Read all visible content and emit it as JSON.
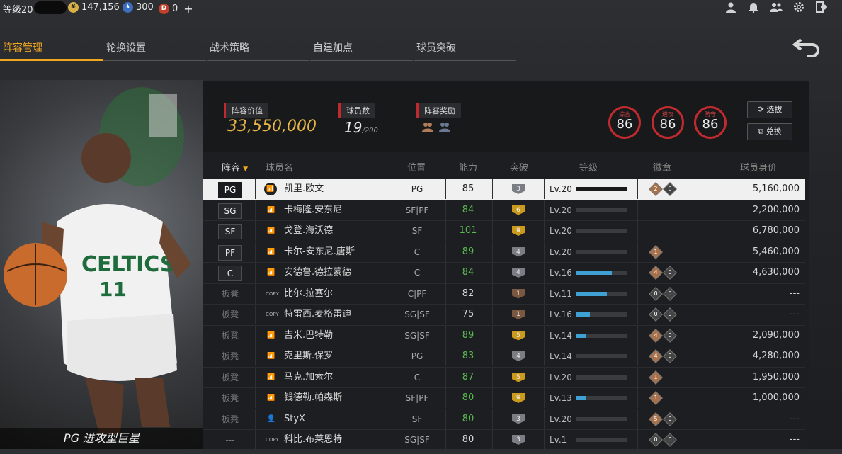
{
  "topbar": {
    "level": "等级20",
    "coins": "147,156",
    "stars": "300",
    "diamonds": "0",
    "plus": "+"
  },
  "tabs": [
    "阵容管理",
    "轮换设置",
    "战术策略",
    "自建加点",
    "球员突破"
  ],
  "art": {
    "caption": "PG 进攻型巨星"
  },
  "summary": {
    "lineup_value_label": "阵容价值",
    "lineup_value": "33,550,000",
    "player_count_label": "球员数",
    "player_count": "19",
    "player_count_max": "/200",
    "reward_label": "阵容奖励",
    "ratings": [
      {
        "label": "综合",
        "value": "86"
      },
      {
        "label": "进攻",
        "value": "86"
      },
      {
        "label": "防守",
        "value": "86"
      }
    ],
    "scout_button": "选拔",
    "exchange_button": "兑换"
  },
  "table": {
    "headers": {
      "lineup": "阵容",
      "name": "球员名",
      "position": "位置",
      "ability": "能力",
      "breakthrough": "突破",
      "level": "等级",
      "badges": "徽章",
      "value": "球员身价"
    },
    "rows": [
      {
        "slot": "PG",
        "bench": false,
        "icon": "bars",
        "name": "凯里.欧文",
        "pos": "PG",
        "ability": "85",
        "green": false,
        "brk": "3",
        "brk_color": "#7a7d84",
        "lv": "Lv.20",
        "lvfill": 1.0,
        "badges": [
          {
            "n": "2",
            "c": "gold"
          },
          {
            "n": "0",
            "c": "grey"
          }
        ],
        "value": "5,160,000",
        "selected": true
      },
      {
        "slot": "SG",
        "bench": false,
        "icon": "bars",
        "name": "卡梅隆.安东尼",
        "pos": "SF|PF",
        "ability": "84",
        "green": true,
        "brk": "6",
        "brk_color": "#c99a1c",
        "lv": "Lv.20",
        "lvfill": 0,
        "badges": [],
        "value": "2,200,000"
      },
      {
        "slot": "SF",
        "bench": false,
        "icon": "bars",
        "name": "戈登.海沃德",
        "pos": "SF",
        "ability": "101",
        "green": true,
        "brk": "♛",
        "brk_color": "#c99a1c",
        "lv": "Lv.20",
        "lvfill": 0,
        "badges": [],
        "value": "6,780,000"
      },
      {
        "slot": "PF",
        "bench": false,
        "icon": "bars",
        "name": "卡尔-安东尼.唐斯",
        "pos": "C",
        "ability": "89",
        "green": true,
        "brk": "4",
        "brk_color": "#7a7d84",
        "lv": "Lv.20",
        "lvfill": 0,
        "badges": [
          {
            "n": "1",
            "c": "gold"
          }
        ],
        "value": "5,460,000"
      },
      {
        "slot": "C",
        "bench": false,
        "icon": "bars",
        "name": "安德鲁.德拉蒙德",
        "pos": "C",
        "ability": "84",
        "green": true,
        "brk": "4",
        "brk_color": "#7a7d84",
        "lv": "Lv.16",
        "lvfill": 0.7,
        "badges": [
          {
            "n": "4",
            "c": "gold"
          },
          {
            "n": "0",
            "c": "grey"
          }
        ],
        "value": "4,630,000"
      },
      {
        "slot": "板凳",
        "bench": true,
        "icon": "COPY",
        "name": "比尔.拉塞尔",
        "pos": "C|PF",
        "ability": "82",
        "green": false,
        "brk": "1",
        "brk_color": "#7a5840",
        "lv": "Lv.11",
        "lvfill": 0.6,
        "badges": [
          {
            "n": "0",
            "c": "grey"
          },
          {
            "n": "0",
            "c": "grey"
          }
        ],
        "value": "---"
      },
      {
        "slot": "板凳",
        "bench": true,
        "icon": "COPY",
        "name": "特雷西.麦格雷迪",
        "pos": "SG|SF",
        "ability": "75",
        "green": false,
        "brk": "1",
        "brk_color": "#7a5840",
        "lv": "Lv.16",
        "lvfill": 0.26,
        "badges": [
          {
            "n": "0",
            "c": "grey"
          },
          {
            "n": "0",
            "c": "grey"
          }
        ],
        "value": "---"
      },
      {
        "slot": "板凳",
        "bench": true,
        "icon": "bars",
        "name": "吉米.巴特勒",
        "pos": "SG|SF",
        "ability": "89",
        "green": true,
        "brk": "5",
        "brk_color": "#c99a1c",
        "lv": "Lv.14",
        "lvfill": 0.2,
        "badges": [
          {
            "n": "4",
            "c": "gold"
          },
          {
            "n": "0",
            "c": "grey"
          }
        ],
        "value": "2,090,000"
      },
      {
        "slot": "板凳",
        "bench": true,
        "icon": "bars",
        "name": "克里斯.保罗",
        "pos": "PG",
        "ability": "83",
        "green": true,
        "brk": "4",
        "brk_color": "#7a7d84",
        "lv": "Lv.14",
        "lvfill": 0,
        "badges": [
          {
            "n": "4",
            "c": "gold"
          },
          {
            "n": "0",
            "c": "grey"
          }
        ],
        "value": "4,280,000"
      },
      {
        "slot": "板凳",
        "bench": true,
        "icon": "bars",
        "name": "马克.加索尔",
        "pos": "C",
        "ability": "87",
        "green": true,
        "brk": "5",
        "brk_color": "#c99a1c",
        "lv": "Lv.20",
        "lvfill": 0,
        "badges": [
          {
            "n": "1",
            "c": "gold"
          }
        ],
        "value": "1,950,000"
      },
      {
        "slot": "板凳",
        "bench": true,
        "icon": "bars",
        "name": "钱德勒.帕森斯",
        "pos": "SF|PF",
        "ability": "80",
        "green": true,
        "brk": "♛",
        "brk_color": "#c99a1c",
        "lv": "Lv.13",
        "lvfill": 0.2,
        "badges": [
          {
            "n": "1",
            "c": "gold"
          }
        ],
        "value": "1,000,000"
      },
      {
        "slot": "板凳",
        "bench": true,
        "icon": "person",
        "name": "StyX",
        "pos": "SF",
        "ability": "80",
        "green": true,
        "brk": "3",
        "brk_color": "#7a7d84",
        "lv": "Lv.20",
        "lvfill": 0,
        "badges": [
          {
            "n": "5",
            "c": "gold"
          },
          {
            "n": "0",
            "c": "grey"
          }
        ],
        "value": "---"
      },
      {
        "slot": "---",
        "bench": true,
        "icon": "COPY",
        "name": "科比.布莱恩特",
        "pos": "SG|SF",
        "ability": "80",
        "green": false,
        "brk": "3",
        "brk_color": "#7a7d84",
        "lv": "Lv.1",
        "lvfill": 0,
        "badges": [
          {
            "n": "0",
            "c": "grey"
          },
          {
            "n": "0",
            "c": "grey"
          }
        ],
        "value": "---"
      }
    ]
  }
}
